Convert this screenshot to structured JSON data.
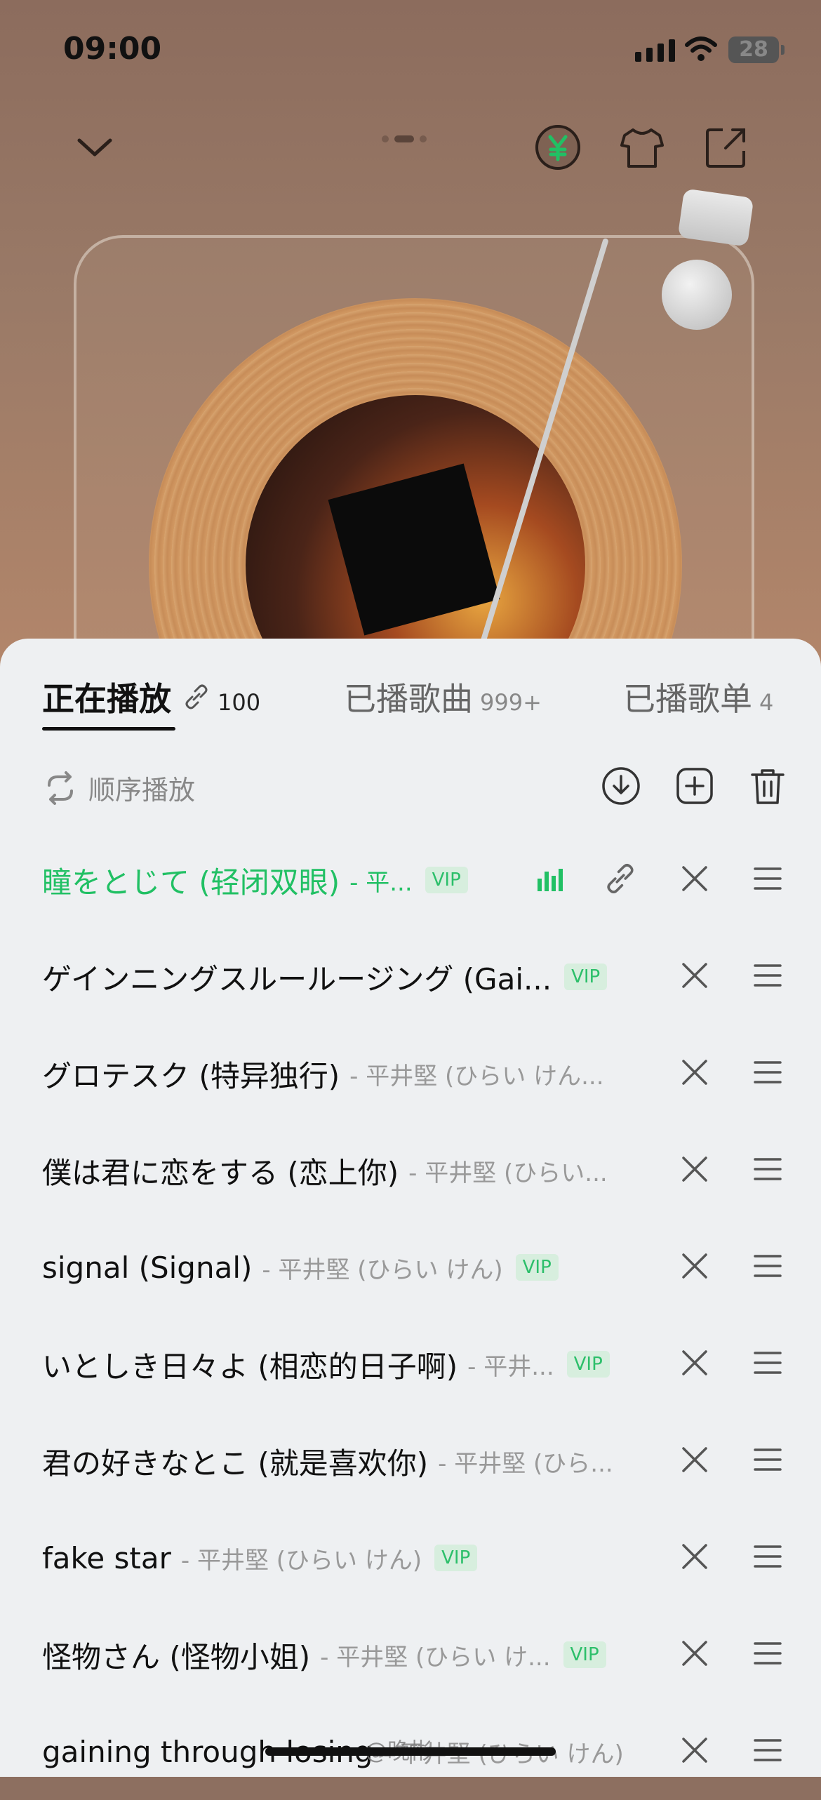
{
  "status": {
    "time": "09:00",
    "battery": "28"
  },
  "tabs": [
    {
      "label": "正在播放",
      "count": "100"
    },
    {
      "label": "已播歌曲",
      "count": "999+"
    },
    {
      "label": "已播歌单",
      "count": "4"
    }
  ],
  "controls": {
    "mode": "顺序播放"
  },
  "songs": [
    {
      "title": "瞳をとじて (轻闭双眼)",
      "artist": "- 平...",
      "vip": "VIP",
      "playing": true
    },
    {
      "title": "ゲインニングスルールージング (Gai...",
      "artist": "",
      "vip": "VIP"
    },
    {
      "title": "グロテスク (特异独行)",
      "artist": "- 平井堅 (ひらい けん...",
      "vip": ""
    },
    {
      "title": "僕は君に恋をする (恋上你)",
      "artist": "- 平井堅 (ひらい...",
      "vip": ""
    },
    {
      "title": "signal (Signal)",
      "artist": "- 平井堅 (ひらい けん)",
      "vip": "VIP"
    },
    {
      "title": "いとしき日々よ (相恋的日子啊)",
      "artist": "- 平井...",
      "vip": "VIP"
    },
    {
      "title": "君の好きなとこ (就是喜欢你)",
      "artist": "- 平井堅 (ひら...",
      "vip": ""
    },
    {
      "title": "fake star",
      "artist": "- 平井堅 (ひらい けん)",
      "vip": "VIP"
    },
    {
      "title": "怪物さん (怪物小姐)",
      "artist": "- 平井堅 (ひらい け...",
      "vip": "VIP"
    },
    {
      "title": "gaining through losing",
      "artist": "- 平井堅 (ひらい けん)",
      "vip": ""
    }
  ],
  "watermark": "@晚彬",
  "colors": {
    "accent": "#21c064",
    "sheet": "#eef0f2",
    "vip_bg": "#d7eede"
  }
}
